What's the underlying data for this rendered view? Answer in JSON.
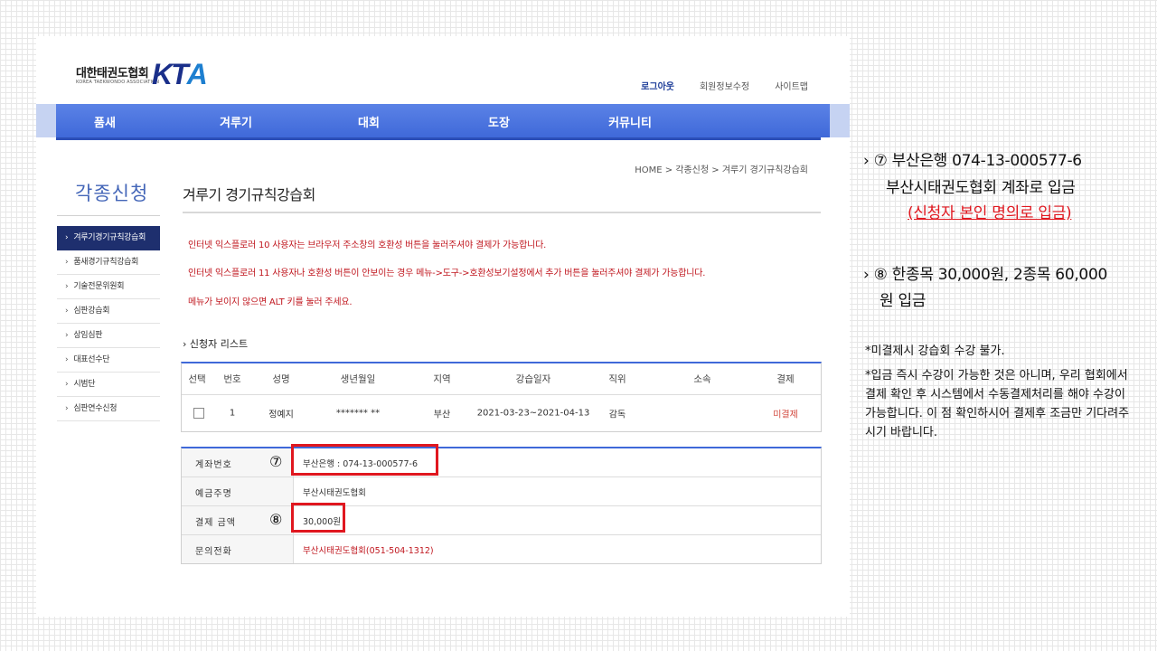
{
  "header": {
    "logo_korean": "대한태권도협회",
    "logo_english": "KOREA TAEKWONDO ASSOCIATION",
    "logo_mark_main": "KT",
    "logo_mark_accent": "A",
    "links": [
      "로그아웃",
      "회원정보수정",
      "사이트맵"
    ]
  },
  "nav": {
    "items": [
      "품새",
      "겨루기",
      "대회",
      "도장",
      "커뮤니티"
    ]
  },
  "breadcrumb": "HOME > 각종신청 > 겨루기 경기규칙강습회",
  "sidebar": {
    "title": "각종신청",
    "items": [
      {
        "label": "겨루기경기규칙강습회",
        "active": true
      },
      {
        "label": "품새경기규칙강습회"
      },
      {
        "label": "기술전문위원회"
      },
      {
        "label": "심판강습회"
      },
      {
        "label": "상임심판"
      },
      {
        "label": "대표선수단"
      },
      {
        "label": "시범단"
      },
      {
        "label": "심판연수신청"
      }
    ]
  },
  "main": {
    "title": "겨루기 경기규칙강습회",
    "notices": [
      "인터넷 익스플로러 10 사용자는 브라우저 주소창의 호환성 버튼을 눌러주셔야 결제가 가능합니다.",
      "인터넷 익스플로러 11 사용자나 호환성 버튼이 안보이는 경우 메뉴->도구->호환성보기설정에서 추가 버튼을 눌러주셔야 결제가 가능합니다.",
      "메뉴가 보이지 않으면 ALT 키를 눌러 주세요."
    ],
    "list_label": "› 신청자 리스트",
    "table": {
      "headers": [
        "선택",
        "번호",
        "성명",
        "생년월일",
        "지역",
        "강습일자",
        "직위",
        "소속",
        "결제"
      ],
      "rows": [
        {
          "no": "1",
          "name": "정예지",
          "birth": "******* **",
          "region": "부산",
          "dates": "2021-03-23~2021-04-13",
          "position": "감독",
          "affiliation": "",
          "payment": "미결제"
        }
      ]
    },
    "payment": [
      {
        "label": "계좌번호",
        "value": "부산은행 : 074-13-000577-6"
      },
      {
        "label": "예금주명",
        "value": "부산시태권도협회"
      },
      {
        "label": "결제 금액",
        "value": "30,000원"
      },
      {
        "label": "문의전화",
        "value": "부산시태권도협회(051-504-1312)"
      }
    ],
    "markers": [
      "⑦",
      "⑧"
    ]
  },
  "annotations": {
    "step7_line1": "› ⑦ 부산은행 074-13-000577-6",
    "step7_line2": "부산시태권도협회 계좌로 입금",
    "step7_line3": "(신청자 본인 명의로 입금)",
    "step8_line1": "› ⑧ 한종목 30,000원, 2종목 60,000",
    "step8_line2": "원 입금",
    "note1": "*미결제시 강습회 수강 불가.",
    "note2": "*입금 즉시 수강이 가능한 것은 아니며, 우리 협회에서 결제 확인 후 시스템에서 수동결제처리를 해야 수강이 가능합니다. 이 점 확인하시어 결제후 조금만 기다려주시기 바랍니다."
  },
  "colors": {
    "nav": "#3f69d9",
    "sidebar_active": "#1e2f6e",
    "notice": "#c0171f",
    "highlight_box": "#e0171f"
  }
}
